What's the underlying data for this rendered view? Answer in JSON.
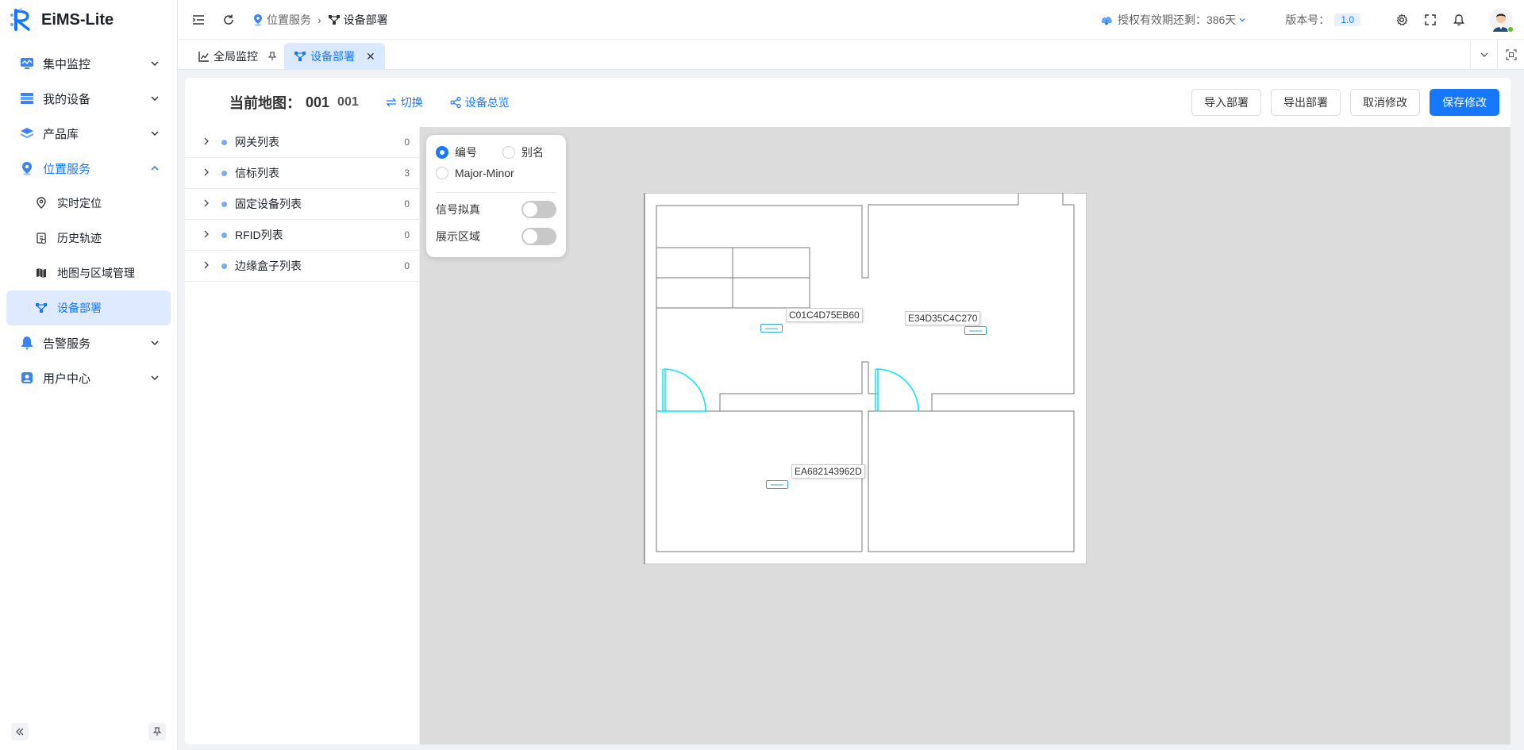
{
  "brand": {
    "name": "EiMS-Lite"
  },
  "sidebar": {
    "items": [
      {
        "label": "集中监控"
      },
      {
        "label": "我的设备"
      },
      {
        "label": "产品库"
      },
      {
        "label": "位置服务",
        "sub": [
          "实时定位",
          "历史轨迹",
          "地图与区域管理",
          "设备部署"
        ]
      },
      {
        "label": "告警服务"
      },
      {
        "label": "用户中心"
      }
    ]
  },
  "header": {
    "breadcrumb": [
      "位置服务",
      "设备部署"
    ],
    "license": "授权有效期还剩：386天",
    "version_label": "版本号：",
    "version": "1.0"
  },
  "tabs": [
    {
      "label": "全局监控"
    },
    {
      "label": "设备部署"
    }
  ],
  "toolbar": {
    "map_title": "当前地图：",
    "map_id": "001",
    "map_id2": "001",
    "switch": "切换",
    "overview": "设备总览",
    "import": "导入部署",
    "export": "导出部署",
    "cancel": "取消修改",
    "save": "保存修改"
  },
  "tree": [
    {
      "label": "网关列表",
      "count": "0"
    },
    {
      "label": "信标列表",
      "count": "3"
    },
    {
      "label": "固定设备列表",
      "count": "0"
    },
    {
      "label": "RFID列表",
      "count": "0"
    },
    {
      "label": "边缘盒子列表",
      "count": "0"
    }
  ],
  "panel": {
    "opt_number": "编号",
    "opt_alias": "别名",
    "opt_major": "Major-Minor",
    "selected": "编号",
    "signal_sim": "信号拟真",
    "signal_sim_on": false,
    "show_area": "展示区域",
    "show_area_on": false
  },
  "devices": [
    {
      "id": "C01C4D75EB60"
    },
    {
      "id": "E34D35C4C270"
    },
    {
      "id": "EA682143962D"
    }
  ],
  "colors": {
    "accent": "#1677ff",
    "door": "#00e5ff",
    "marker": "#31a8e6"
  }
}
